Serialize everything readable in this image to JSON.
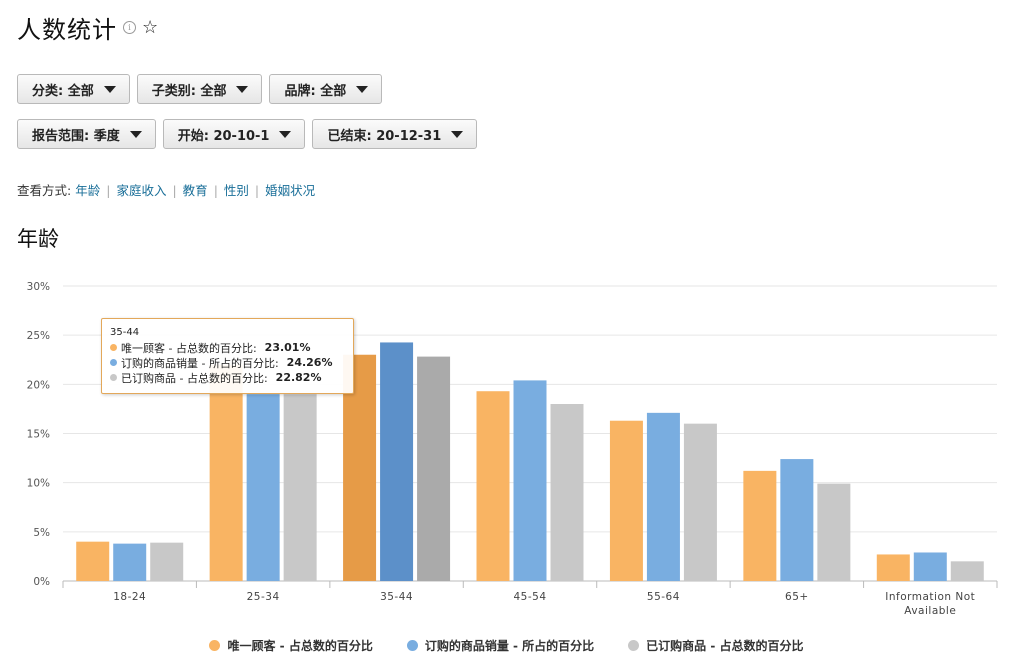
{
  "page": {
    "title": "人数统计",
    "info_icon": "info-icon",
    "favorite_icon": "star-icon"
  },
  "filters": {
    "row1": [
      {
        "label": "分类: 全部"
      },
      {
        "label": "子类别: 全部"
      },
      {
        "label": "品牌: 全部"
      }
    ],
    "row2": [
      {
        "label": "报告范围: 季度"
      },
      {
        "label": "开始: 20-10-1"
      },
      {
        "label": "已结束: 20-12-31"
      }
    ]
  },
  "view_by": {
    "prefix": "查看方式:",
    "options": [
      "年龄",
      "家庭收入",
      "教育",
      "性别",
      "婚姻状况"
    ]
  },
  "section_title": "年龄",
  "chart_data": {
    "type": "bar",
    "categories": [
      "18-24",
      "25-34",
      "35-44",
      "45-54",
      "55-64",
      "65+",
      "Information Not Available"
    ],
    "series": [
      {
        "name": "唯一顾客 - 占总数的百分比",
        "color": "#f9b463",
        "values": [
          4.0,
          22.0,
          23.01,
          19.3,
          16.3,
          11.2,
          2.7
        ]
      },
      {
        "name": "订购的商品销量 - 所占的百分比",
        "color": "#79ade0",
        "values": [
          3.8,
          19.0,
          24.26,
          20.4,
          17.1,
          12.4,
          2.9
        ]
      },
      {
        "name": "已订购商品 - 占总数的百分比",
        "color": "#c8c8c8",
        "values": [
          3.9,
          19.0,
          22.82,
          18.0,
          16.0,
          9.9,
          2.0
        ]
      }
    ],
    "highlighted_category_index": 2,
    "highlight_colors": [
      "#e69b47",
      "#5c90c9",
      "#aaaaaa"
    ],
    "y_ticks": [
      "0%",
      "5%",
      "10%",
      "15%",
      "20%",
      "25%",
      "30%"
    ],
    "ylim": [
      0,
      30
    ],
    "grid": true,
    "legend_position": "bottom-center"
  },
  "tooltip": {
    "header": "35-44",
    "lines": [
      {
        "label": "唯一顾客 - 占总数的百分比:",
        "value": "23.01%",
        "color": "#f9b463"
      },
      {
        "label": "订购的商品销量 - 所占的百分比:",
        "value": "24.26%",
        "color": "#79ade0"
      },
      {
        "label": "已订购商品 - 占总数的百分比:",
        "value": "22.82%",
        "color": "#c8c8c8"
      }
    ]
  }
}
